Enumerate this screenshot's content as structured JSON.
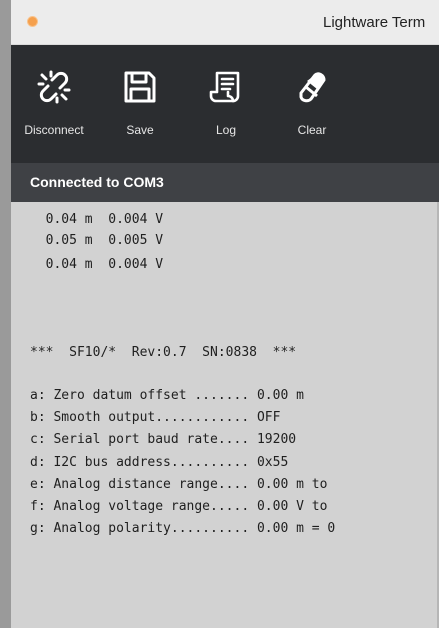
{
  "window": {
    "title": "Lightware Term"
  },
  "toolbar": {
    "buttons": [
      {
        "label": "Disconnect",
        "icon": "broken-link-icon"
      },
      {
        "label": "Save",
        "icon": "floppy-disk-icon"
      },
      {
        "label": "Log",
        "icon": "document-icon"
      },
      {
        "label": "Clear",
        "icon": "eraser-icon"
      }
    ]
  },
  "status": {
    "text": "Connected to COM3"
  },
  "terminal": {
    "readings": [
      "  0.04 m  0.004 V",
      "  0.05 m  0.005 V",
      "  0.04 m  0.004 V"
    ],
    "header": "***  SF10/*  Rev:0.7  SN:0838  ***",
    "menu": [
      "a: Zero datum offset ....... 0.00 m",
      "b: Smooth output............ OFF",
      "c: Serial port baud rate.... 19200",
      "d: I2C bus address.......... 0x55",
      "e: Analog distance range.... 0.00 m to",
      "f: Analog voltage range..... 0.00 V to",
      "g: Analog polarity.......... 0.00 m = 0"
    ]
  },
  "colors": {
    "toolbar_bg": "#2b2d30",
    "status_bg": "#3f4145",
    "terminal_bg": "#d2d2d2",
    "app_icon": "#f5a04d"
  }
}
